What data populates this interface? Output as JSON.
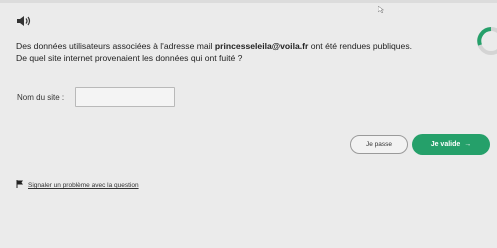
{
  "question": {
    "line1_prefix": "Des données utilisateurs associées à l'adresse mail ",
    "email": "princesseleila@voila.fr",
    "line1_suffix": " ont été rendues publiques.",
    "line2": "De quel site internet provenaient les données qui ont fuité ?"
  },
  "form": {
    "site_label": "Nom du site :",
    "site_value": ""
  },
  "buttons": {
    "pass_label": "Je passe",
    "validate_label": "Je valide",
    "validate_arrow": "→"
  },
  "report": {
    "label": "Signaler un problème avec la question"
  },
  "icons": {
    "audio": "speaker-icon",
    "progress": "progress-ring-icon",
    "report": "flag-icon"
  },
  "colors": {
    "background": "#ebebeb",
    "primary": "#25a06a",
    "secondary_border": "#9a9a9a"
  }
}
